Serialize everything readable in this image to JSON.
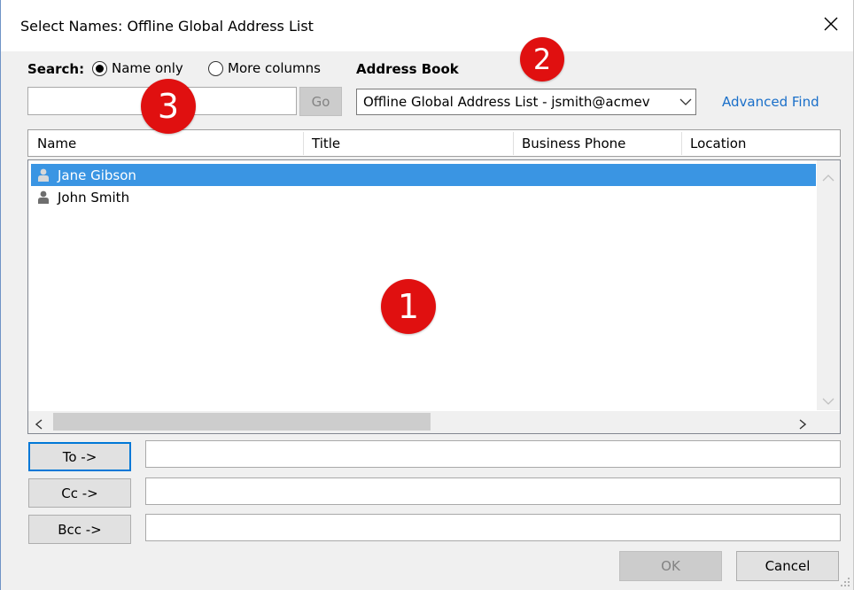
{
  "window": {
    "title": "Select Names: Offline Global Address List",
    "close_glyph": "✕"
  },
  "search": {
    "label": "Search:",
    "radio_name_only": "Name only",
    "radio_more_columns": "More columns",
    "selected_option": "Name only",
    "input_value": "",
    "go_label": "Go"
  },
  "address_book": {
    "label": "Address Book",
    "selected": "Offline Global Address List - jsmith@acmev",
    "advanced_find": "Advanced Find"
  },
  "columns": [
    "Name",
    "Title",
    "Business Phone",
    "Location"
  ],
  "contacts": [
    {
      "name": "Jane Gibson",
      "selected": true
    },
    {
      "name": "John Smith",
      "selected": false
    }
  ],
  "scroll": {
    "up": "˄",
    "down": "˅",
    "left": "<",
    "right": ">"
  },
  "recipients": {
    "to_label": "To ->",
    "cc_label": "Cc ->",
    "bcc_label": "Bcc ->",
    "to_value": "",
    "cc_value": "",
    "bcc_value": ""
  },
  "footer": {
    "ok_label": "OK",
    "cancel_label": "Cancel"
  },
  "callouts": [
    "1",
    "2",
    "3"
  ],
  "colors": {
    "selection": "#3a95e3",
    "link": "#1a6fc9",
    "callout": "#e01010",
    "default_button_border": "#0078d7"
  },
  "icons": {
    "contact": "person-icon",
    "close": "close-icon",
    "dropdown": "chevron-down-icon"
  }
}
